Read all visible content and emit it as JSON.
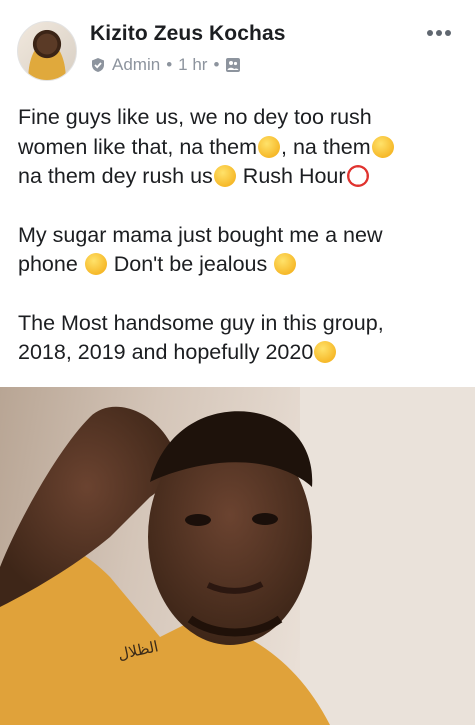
{
  "post": {
    "author_name": "Kizito Zeus Kochas",
    "role": "Admin",
    "separator": "•",
    "time": "1 hr",
    "paragraphs": {
      "p1": {
        "line1": "Fine guys like us, we no dey too rush",
        "line2_a": "women like that, na them",
        "line2_b": ", na them",
        "line3_a": "na them dey rush us",
        "line3_b": "  Rush Hour"
      },
      "p2": {
        "line1": "My sugar mama just bought me a new",
        "line2_a": "phone ",
        "line2_b": " Don't be jealous "
      },
      "p3": {
        "line1": "The Most handsome guy in this group,",
        "line2": "2018, 2019 and hopefully 2020"
      }
    },
    "photo_shirt_text": "الظلال"
  },
  "icons": {
    "admin": "shield-check-icon",
    "audience": "group-photo-icon",
    "more": "more-dots-icon"
  },
  "colors": {
    "text": "#1c1e21",
    "meta": "#8d949e",
    "shirt": "#e0a23a"
  }
}
